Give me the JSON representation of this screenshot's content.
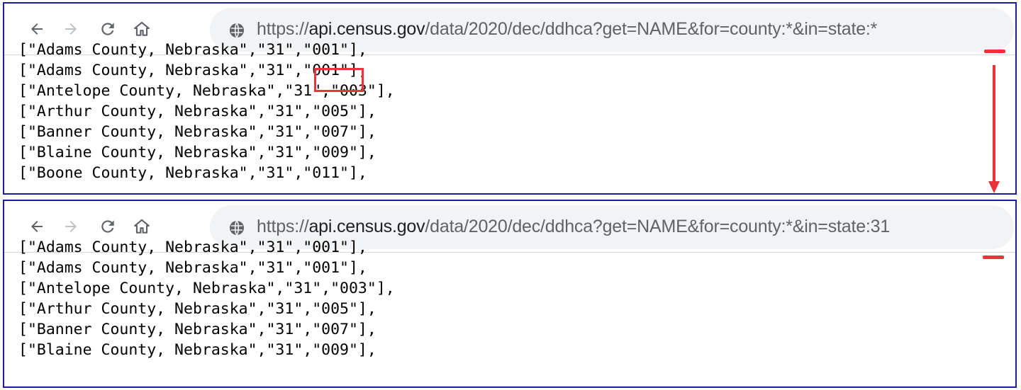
{
  "top_window": {
    "url": {
      "scheme": "https://",
      "host": "api.census.gov",
      "path": "/data/2020/dec/ddhca?get=NAME&for=county:*&in=state:*"
    },
    "lines": [
      "[\"Adams County, Nebraska\",\"31\",\"001\"],",
      "[\"Antelope County, Nebraska\",\"31\",\"003\"],",
      "[\"Arthur County, Nebraska\",\"31\",\"005\"],",
      "[\"Banner County, Nebraska\",\"31\",\"007\"],",
      "[\"Blaine County, Nebraska\",\"31\",\"009\"],"
    ],
    "partial_above": "[\"Adams County, Nebraska\",\"31\",\"001\"],",
    "partial_below": "[\"Boone County, Nebraska\",\"31\",\"011\"],"
  },
  "bottom_window": {
    "url": {
      "scheme": "https://",
      "host": "api.census.gov",
      "path": "/data/2020/dec/ddhca?get=NAME&for=county:*&in=state:31"
    },
    "lines": [
      "[\"Adams County, Nebraska\",\"31\",\"001\"],",
      "[\"Antelope County, Nebraska\",\"31\",\"003\"],",
      "[\"Arthur County, Nebraska\",\"31\",\"005\"],",
      "[\"Banner County, Nebraska\",\"31\",\"007\"],",
      "[\"Blaine County, Nebraska\",\"31\",\"009\"],"
    ],
    "partial_above": "[\"Adams County, Nebraska\",\"31\",\"001\"],"
  },
  "icons": {
    "back": "arrow-left-icon",
    "forward": "arrow-right-icon",
    "reload": "reload-icon",
    "home": "home-icon",
    "site_info": "globe-icon"
  },
  "colors": {
    "annotation": "#e8343a",
    "panel_border": "#1b1f9c",
    "omnibox_bg": "#f1f3f4"
  }
}
